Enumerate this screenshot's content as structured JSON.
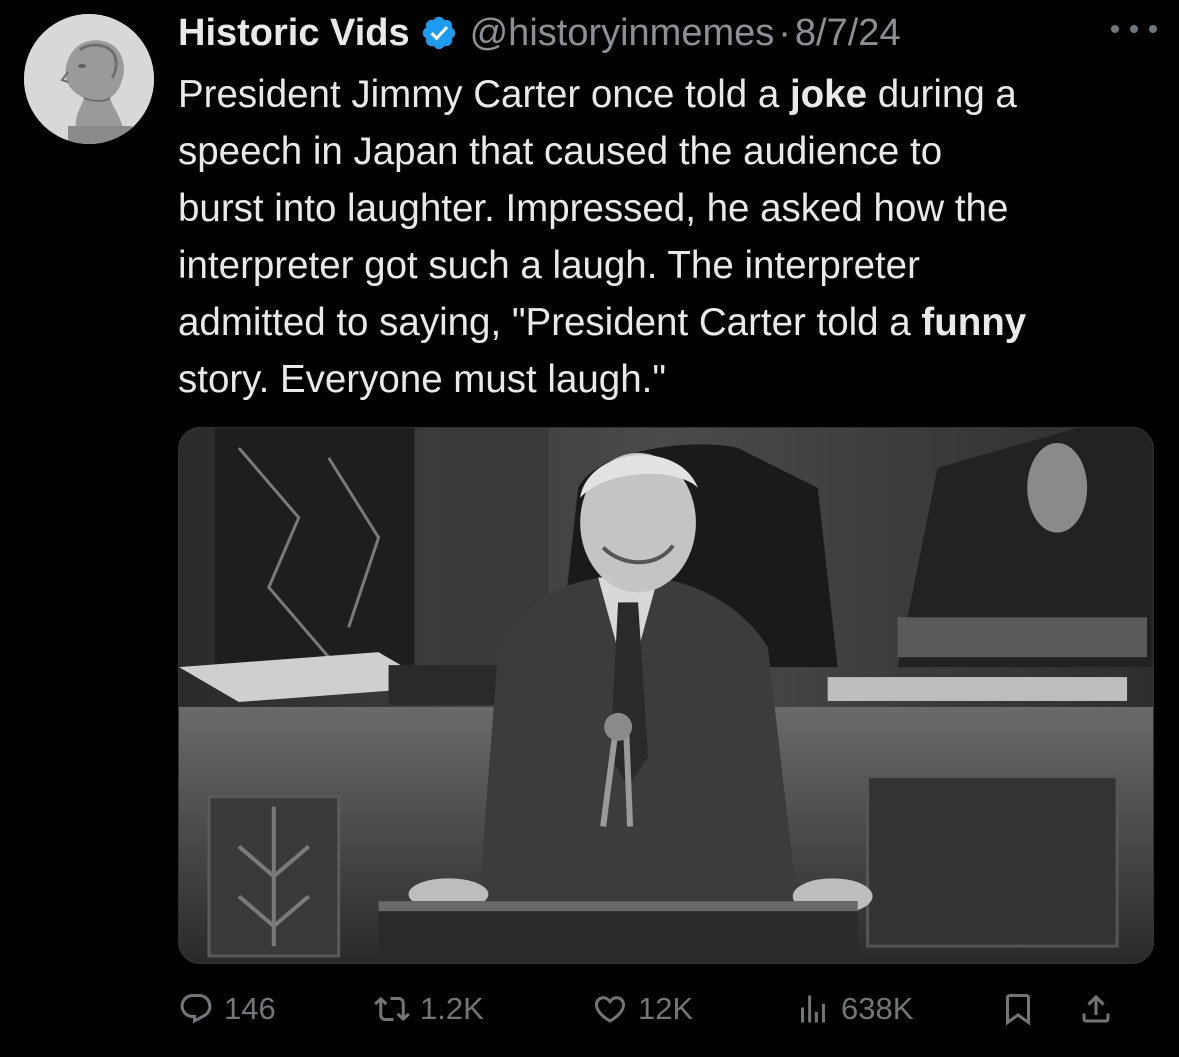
{
  "author": {
    "display_name": "Historic Vids",
    "handle": "@historyinmemes",
    "separator": "·",
    "date": "8/7/24",
    "avatar_icon": "marble-bust-avatar",
    "verified_color": "#1d9bf0"
  },
  "tweet": {
    "lines": [
      [
        {
          "t": "President Jimmy Carter once told a "
        },
        {
          "t": "joke",
          "b": true
        },
        {
          "t": " during a"
        }
      ],
      [
        {
          "t": "speech in Japan that caused the audience to"
        }
      ],
      [
        {
          "t": "burst into laughter. Impressed, he asked how the"
        }
      ],
      [
        {
          "t": "interpreter got such a laugh. The interpreter"
        }
      ],
      [
        {
          "t": "admitted to saying, \"President Carter told a "
        },
        {
          "t": "funny",
          "b": true
        }
      ],
      [
        {
          "t": "story. Everyone must laugh.\""
        }
      ]
    ]
  },
  "media": {
    "image_icon": "photo-speaker-at-podium"
  },
  "actions": {
    "reply_count": "146",
    "retweet_count": "1.2K",
    "like_count": "12K",
    "views_count": "638K"
  },
  "colors": {
    "background": "#000000",
    "text": "#e7e9ea",
    "muted": "#71767b",
    "accent": "#1d9bf0"
  }
}
